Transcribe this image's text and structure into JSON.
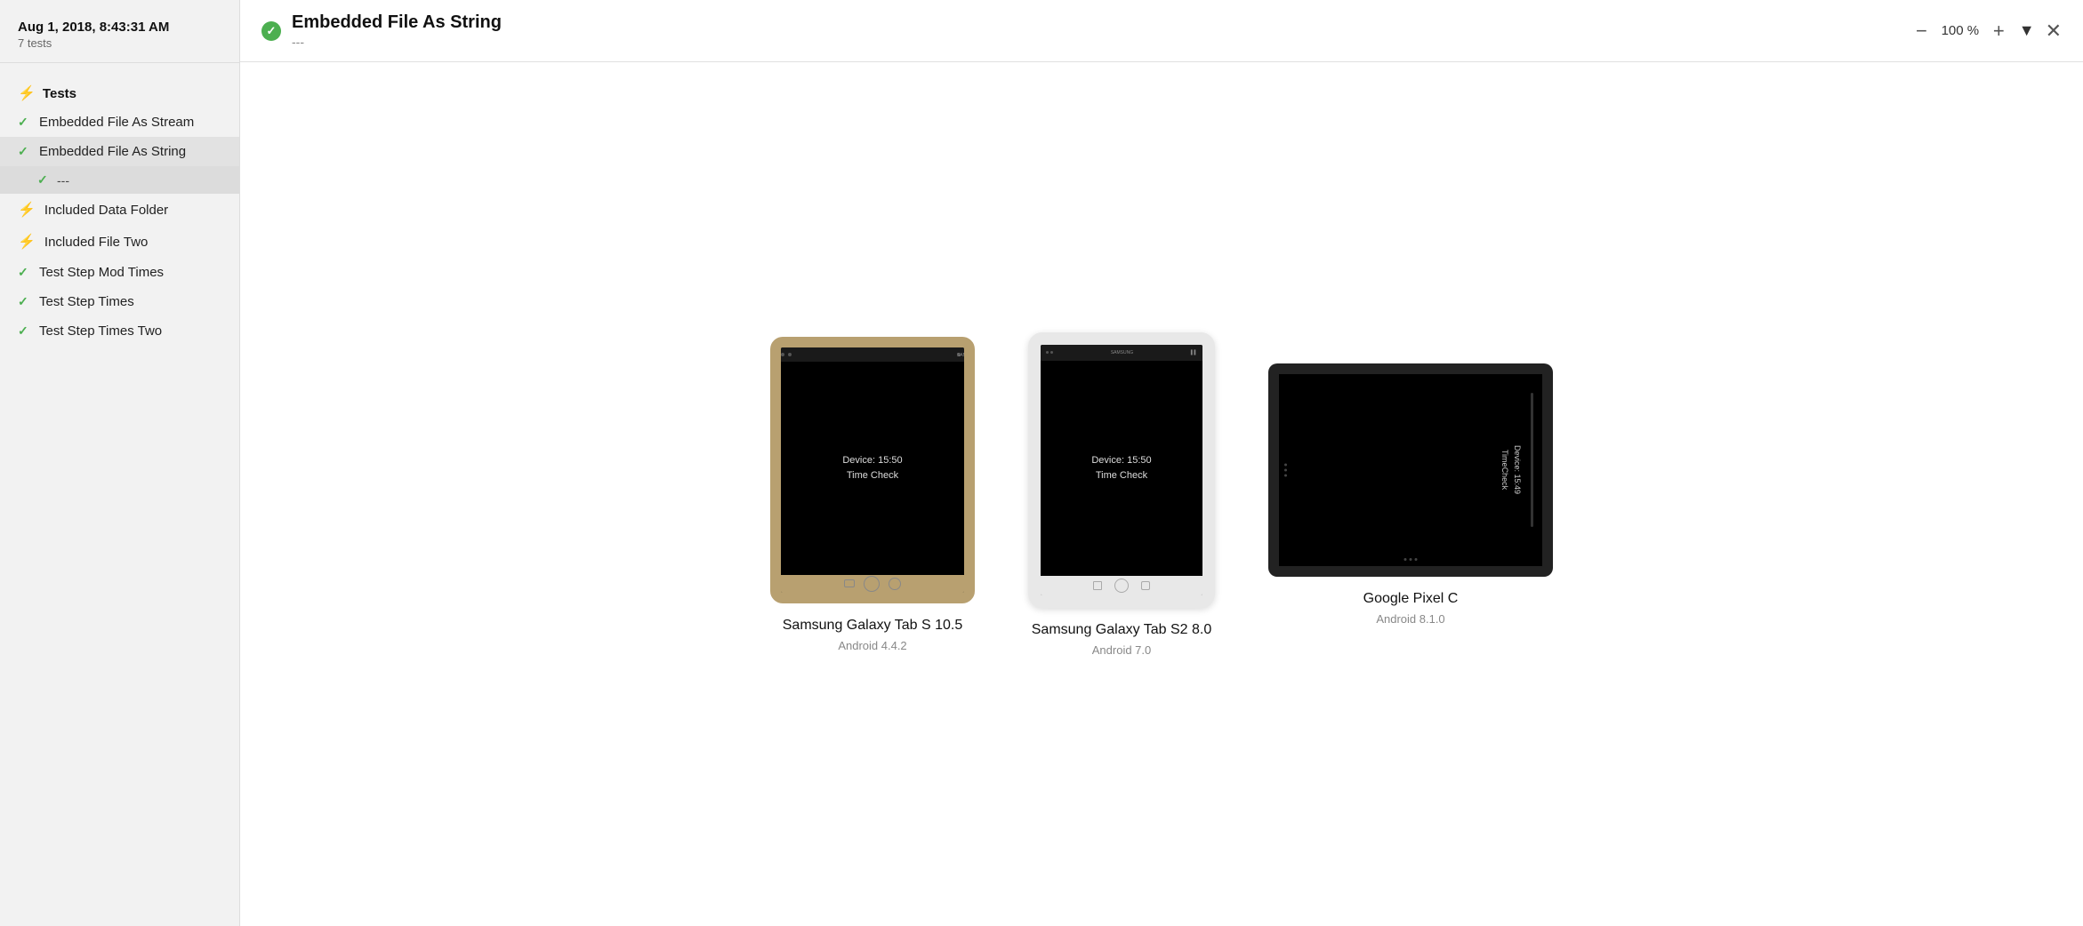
{
  "sidebar": {
    "date": "Aug 1, 2018, 8:43:31 AM",
    "test_count": "7 tests",
    "section_label": "Tests",
    "items": [
      {
        "id": "embedded-file-as-stream",
        "label": "Embedded File As Stream",
        "status": "pass",
        "active": false
      },
      {
        "id": "embedded-file-as-string",
        "label": "Embedded File As String",
        "status": "pass",
        "active": true
      },
      {
        "id": "embedded-file-as-string-sub",
        "label": "---",
        "status": "pass",
        "active": true,
        "sub": true
      },
      {
        "id": "included-data-folder",
        "label": "Included Data Folder",
        "status": "fail",
        "active": false
      },
      {
        "id": "included-file-two",
        "label": "Included File Two",
        "status": "fail",
        "active": false
      },
      {
        "id": "test-step-mod-times",
        "label": "Test Step Mod Times",
        "status": "pass",
        "active": false
      },
      {
        "id": "test-step-times",
        "label": "Test Step Times",
        "status": "pass",
        "active": false
      },
      {
        "id": "test-step-times-two",
        "label": "Test Step Times Two",
        "status": "pass",
        "active": false
      }
    ]
  },
  "topbar": {
    "title": "Embedded File As String",
    "subtitle": "---",
    "zoom_label": "100 %",
    "zoom_minus": "−",
    "zoom_plus": "+",
    "filter_label": "Filter",
    "close_label": "✕"
  },
  "devices": [
    {
      "id": "samsung-tab-s105",
      "name": "Samsung Galaxy Tab S 10.5",
      "os": "Android 4.4.2",
      "type": "tablet-s105",
      "screen_line1": "Device: 15:50",
      "screen_line2": "Time Check"
    },
    {
      "id": "samsung-tab-s2",
      "name": "Samsung Galaxy Tab S2 8.0",
      "os": "Android 7.0",
      "type": "tablet-s2",
      "screen_line1": "Device: 15:50",
      "screen_line2": "Time Check"
    },
    {
      "id": "google-pixel-c",
      "name": "Google Pixel C",
      "os": "Android 8.1.0",
      "type": "tablet-pixel",
      "screen_line1": "Device: 15:49",
      "screen_line2": "TimeCheck"
    }
  ]
}
